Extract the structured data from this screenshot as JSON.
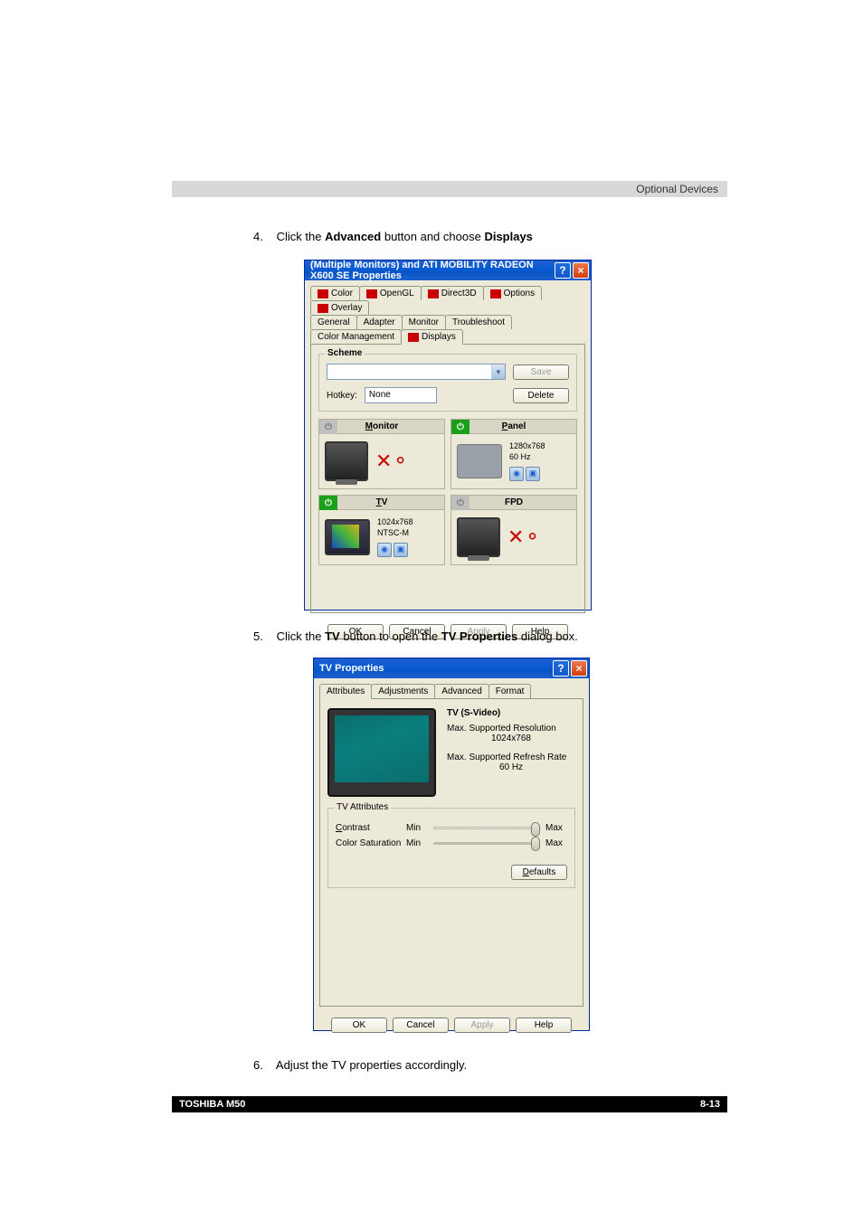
{
  "header": {
    "section_title": "Optional Devices"
  },
  "steps": {
    "s4_num": "4.",
    "s4_pre": "Click the ",
    "s4_b1": "Advanced",
    "s4_mid": " button and choose ",
    "s4_b2": "Displays",
    "s5_num": "5.",
    "s5_pre": "Click the ",
    "s5_b1": "TV",
    "s5_mid": " button to open the ",
    "s5_b2": "TV Properties",
    "s5_post": " dialog box.",
    "s6_num": "6.",
    "s6_text": "Adjust the TV properties accordingly."
  },
  "dialog1": {
    "title": "(Multiple Monitors) and ATI MOBILITY RADEON X600 SE Properties",
    "tabs_row1": {
      "color": "Color",
      "opengl": "OpenGL",
      "d3d": "Direct3D",
      "options": "Options",
      "overlay": "Overlay"
    },
    "tabs_row2": {
      "general": "General",
      "adapter": "Adapter",
      "monitor": "Monitor",
      "troubleshoot": "Troubleshoot",
      "colormgmt": "Color Management",
      "displays": "Displays"
    },
    "scheme": {
      "label": "Scheme",
      "hotkey_label": "Hotkey:",
      "hotkey_value": "None",
      "save": "Save",
      "delete": "Delete"
    },
    "cells": {
      "monitor": {
        "title": "Monitor"
      },
      "panel": {
        "title": "Panel",
        "res": "1280x768",
        "hz": "60 Hz"
      },
      "tv": {
        "title": "TV",
        "res": "1024x768",
        "mode": "NTSC-M"
      },
      "fpd": {
        "title": "FPD"
      }
    },
    "buttons": {
      "ok": "OK",
      "cancel": "Cancel",
      "apply": "Apply",
      "help": "Help"
    }
  },
  "dialog2": {
    "title": "TV Properties",
    "tabs": {
      "attributes": "Attributes",
      "adjustments": "Adjustments",
      "advanced": "Advanced",
      "format": "Format"
    },
    "info": {
      "heading": "TV (S-Video)",
      "maxres_label": "Max. Supported Resolution",
      "maxres_value": "1024x768",
      "maxhz_label": "Max. Supported Refresh Rate",
      "maxhz_value": "60 Hz"
    },
    "attrs": {
      "group": "TV Attributes",
      "contrast": "Contrast",
      "colorsat": "Color Saturation",
      "min": "Min",
      "max": "Max",
      "defaults": "Defaults"
    },
    "buttons": {
      "ok": "OK",
      "cancel": "Cancel",
      "apply": "Apply",
      "help": "Help"
    }
  },
  "footer": {
    "left": "TOSHIBA M50",
    "right": "8-13"
  }
}
